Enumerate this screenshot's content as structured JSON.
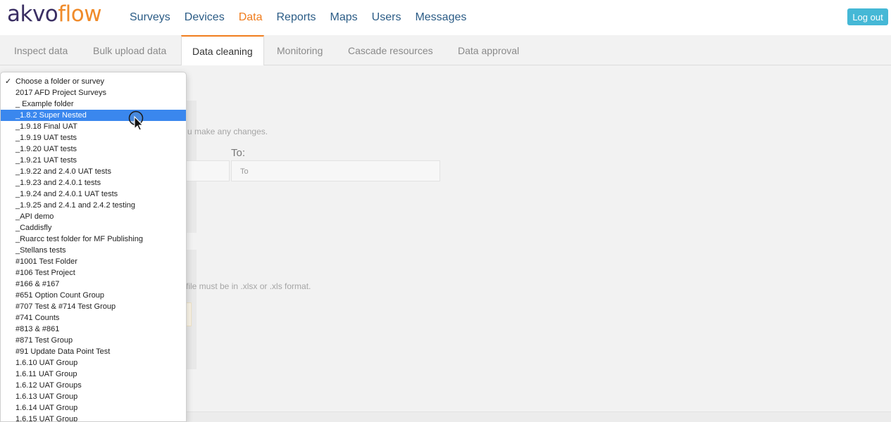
{
  "app": {
    "logo_part1": "akvo",
    "logo_part2": "flow"
  },
  "nav": {
    "items": [
      "Surveys",
      "Devices",
      "Data",
      "Reports",
      "Maps",
      "Users",
      "Messages"
    ],
    "active": "Data",
    "logout_label": "Log out"
  },
  "subtabs": {
    "items": [
      "Inspect data",
      "Bulk upload data",
      "Data cleaning",
      "Monitoring",
      "Cascade resources",
      "Data approval"
    ],
    "active": "Data cleaning"
  },
  "background": {
    "hint_changes": "u make any changes.",
    "to_label": "To:",
    "to_placeholder": "To",
    "format_hint": "file must be in .xlsx or .xls format."
  },
  "dropdown": {
    "selected": "_1.8.2 Super Nested",
    "options": [
      "Choose a folder or survey",
      "2017 AFD Project Surveys",
      "_ Example folder",
      "_1.8.2 Super Nested",
      "_1.9.18 Final UAT",
      "_1.9.19 UAT tests",
      "_1.9.20 UAT tests",
      "_1.9.21 UAT tests",
      "_1.9.22 and 2.4.0 UAT tests",
      "_1.9.23 and 2.4.0.1 tests",
      "_1.9.24 and 2.4.0.1 UAT tests",
      "_1.9.25 and 2.4.1 and 2.4.2 testing",
      "_API demo",
      "_Caddisfly",
      "_Ruarcc test folder for MF Publishing",
      "_Stellans tests",
      "#1001 Test Folder",
      "#106 Test Project",
      "#166 & #167",
      "#651 Option Count Group",
      "#707 Test & #714 Test Group",
      "#741 Counts",
      "#813 & #861",
      "#871 Test Group",
      "#91 Update Data Point Test",
      "1.6.10 UAT Group",
      "1.6.11 UAT Group",
      "1.6.12 UAT Groups",
      "1.6.13 UAT Group",
      "1.6.14 UAT Group",
      "1.6.15 UAT Group"
    ],
    "checkmark": "✓"
  },
  "colors": {
    "accent": "#f07d1e",
    "selection": "#3a87ee",
    "button": "#45b8d6",
    "nav_link": "#2b5c86"
  },
  "icons": {
    "cursor": "mouse-pointer-icon"
  }
}
